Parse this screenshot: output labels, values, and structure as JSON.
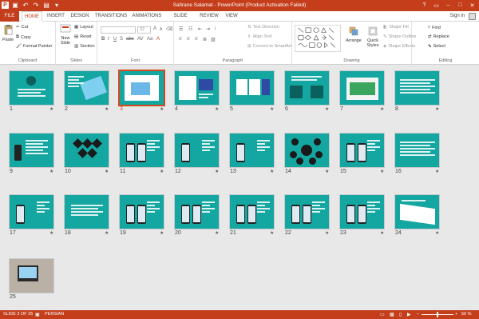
{
  "window": {
    "title": "Safirane Salamat - PowerPoint (Product Activation Failed)",
    "sign_in": "Sign in",
    "minimize_glyph": "–",
    "restore_glyph": "□",
    "close_glyph": "✕",
    "help_glyph": "?"
  },
  "quick_access": {
    "logo": "P",
    "save_glyph": "▣",
    "undo_glyph": "↶",
    "redo_glyph": "↷",
    "start_glyph": "▤",
    "customize_glyph": "▾"
  },
  "tabs": [
    "FILE",
    "HOME",
    "INSERT",
    "DESIGN",
    "TRANSITIONS",
    "ANIMATIONS",
    "SLIDE SHOW",
    "REVIEW",
    "VIEW"
  ],
  "ribbon": {
    "clipboard": {
      "label": "Clipboard",
      "paste": "Paste",
      "cut": "Cut",
      "copy": "Copy",
      "format_painter": "Format Painter"
    },
    "slides": {
      "label": "Slides",
      "new_slide": "New Slide",
      "layout": "Layout",
      "reset": "Reset",
      "section": "Section"
    },
    "font": {
      "label": "Font",
      "size_value": "32"
    },
    "paragraph": {
      "label": "Paragraph",
      "text_direction": "Text Direction",
      "align_text": "Align Text",
      "convert_smartart": "Convert to SmartArt"
    },
    "drawing": {
      "label": "Drawing",
      "arrange": "Arrange",
      "quick_styles": "Quick Styles",
      "shape_fill": "Shape Fill",
      "shape_outline": "Shape Outline",
      "shape_effects": "Shape Effects"
    },
    "editing": {
      "label": "Editing",
      "find": "Find",
      "replace": "Replace",
      "select": "Select"
    }
  },
  "slides": [
    {
      "n": "1"
    },
    {
      "n": "2"
    },
    {
      "n": "3"
    },
    {
      "n": "4"
    },
    {
      "n": "5"
    },
    {
      "n": "6"
    },
    {
      "n": "7"
    },
    {
      "n": "8"
    },
    {
      "n": "9"
    },
    {
      "n": "10"
    },
    {
      "n": "11"
    },
    {
      "n": "12"
    },
    {
      "n": "13"
    },
    {
      "n": "14"
    },
    {
      "n": "15"
    },
    {
      "n": "16"
    },
    {
      "n": "17"
    },
    {
      "n": "18"
    },
    {
      "n": "19"
    },
    {
      "n": "20"
    },
    {
      "n": "21"
    },
    {
      "n": "22"
    },
    {
      "n": "23"
    },
    {
      "n": "24"
    },
    {
      "n": "25"
    }
  ],
  "selected_slide": "3",
  "transition_star": "★",
  "statusbar": {
    "slide_info": "SLIDE 3 OF 25",
    "language": "PERSIAN",
    "zoom": "50 %",
    "zoom_minus": "–",
    "zoom_plus": "+"
  },
  "colors": {
    "accent": "#c43e1c",
    "slide_bg": "#14a6a0",
    "selection": "#d04a22"
  }
}
